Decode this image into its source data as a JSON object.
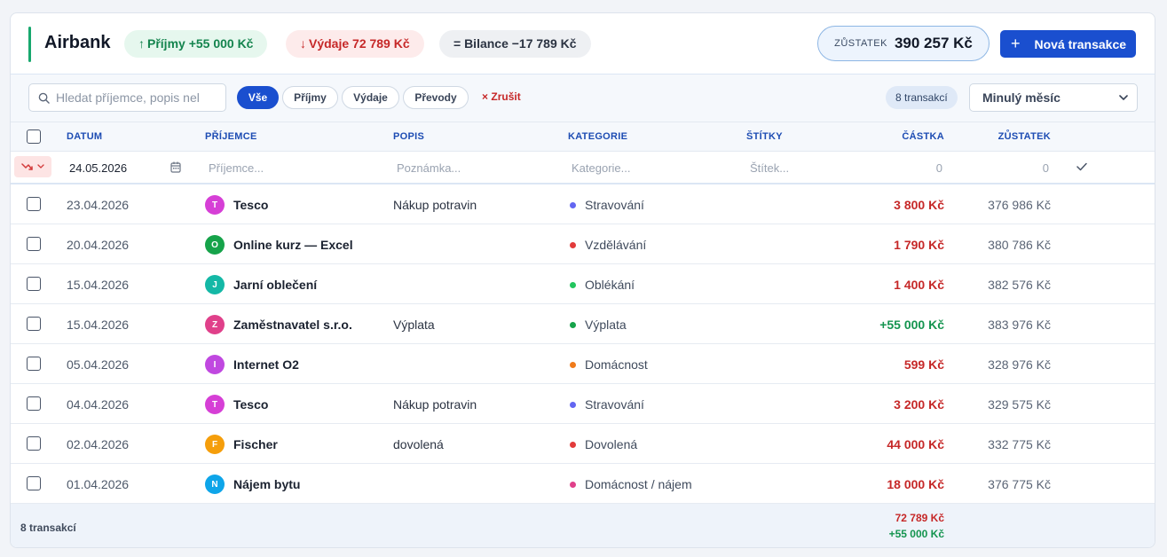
{
  "header": {
    "title": "Airbank",
    "income_arrow": "↑",
    "income_label": "Příjmy +55 000 Kč",
    "expense_arrow": "↓",
    "expense_label": "Výdaje 72 789 Kč",
    "balance_label": "= Bilance −17 789 Kč",
    "account_balance_label": "ZŮSTATEK",
    "account_balance_value": "390 257 Kč",
    "new_button_label": "Nová transakce"
  },
  "filters": {
    "search_placeholder": "Hledat příjemce, popis nel",
    "segments": [
      "Vše",
      "Příjmy",
      "Výdaje",
      "Převody"
    ],
    "active_segment": "Vše",
    "clear_label": "Zrušit",
    "count_badge": "8 transakcí",
    "period_selected": "Minulý měsíc"
  },
  "table": {
    "columns": {
      "date": "DATUM",
      "payee": "PŘÍJEMCE",
      "description": "POPIS",
      "category": "KATEGORIE",
      "tags": "ŠTÍTKY",
      "amount": "ČÁSTKA",
      "balance": "ZŮSTATEK"
    },
    "entry": {
      "date_value": "24.05.2026",
      "payee_placeholder": "Příjemce...",
      "note_placeholder": "Poznámka...",
      "category_placeholder": "Kategorie...",
      "tag_placeholder": "Štítek...",
      "amount_placeholder": "0",
      "balance_placeholder": "0"
    },
    "rows": [
      {
        "date": "23.04.2026",
        "initial": "T",
        "avatar_color": "#d63fd6",
        "payee": "Tesco",
        "description": "Nákup potravin",
        "category": "Stravování",
        "category_color": "#6366f1",
        "amount": "3 800 Kč",
        "sign": "neg",
        "balance": "376 986 Kč"
      },
      {
        "date": "20.04.2026",
        "initial": "O",
        "avatar_color": "#16a34a",
        "payee": "Online kurz — Excel",
        "description": "",
        "category": "Vzdělávání",
        "category_color": "#e23b3b",
        "amount": "1 790 Kč",
        "sign": "neg",
        "balance": "380 786 Kč"
      },
      {
        "date": "15.04.2026",
        "initial": "J",
        "avatar_color": "#14b8a6",
        "payee": "Jarní oblečení",
        "description": "",
        "category": "Oblékání",
        "category_color": "#22c55e",
        "amount": "1 400 Kč",
        "sign": "neg",
        "balance": "382 576 Kč"
      },
      {
        "date": "15.04.2026",
        "initial": "Z",
        "avatar_color": "#e0408a",
        "payee": "Zaměstnavatel s.r.o.",
        "description": "Výplata",
        "category": "Výplata",
        "category_color": "#16a34a",
        "amount": "+55 000 Kč",
        "sign": "pos",
        "balance": "383 976 Kč"
      },
      {
        "date": "05.04.2026",
        "initial": "I",
        "avatar_color": "#c048e0",
        "payee": "Internet O2",
        "description": "",
        "category": "Domácnost",
        "category_color": "#f07b1a",
        "amount": "599 Kč",
        "sign": "neg",
        "balance": "328 976 Kč"
      },
      {
        "date": "04.04.2026",
        "initial": "T",
        "avatar_color": "#d63fd6",
        "payee": "Tesco",
        "description": "Nákup potravin",
        "category": "Stravování",
        "category_color": "#6366f1",
        "amount": "3 200 Kč",
        "sign": "neg",
        "balance": "329 575 Kč"
      },
      {
        "date": "02.04.2026",
        "initial": "F",
        "avatar_color": "#f59e0b",
        "payee": "Fischer",
        "description": "dovolená",
        "category": "Dovolená",
        "category_color": "#e23b3b",
        "amount": "44 000 Kč",
        "sign": "neg",
        "balance": "332 775 Kč"
      },
      {
        "date": "01.04.2026",
        "initial": "N",
        "avatar_color": "#0ea5e9",
        "payee": "Nájem bytu",
        "description": "",
        "category": "Domácnost / nájem",
        "category_color": "#e0408a",
        "amount": "18 000 Kč",
        "sign": "neg",
        "balance": "376 775 Kč"
      }
    ]
  },
  "footer": {
    "count": "8 transakcí",
    "total_expense": "72 789 Kč",
    "total_income": "+55 000 Kč"
  }
}
